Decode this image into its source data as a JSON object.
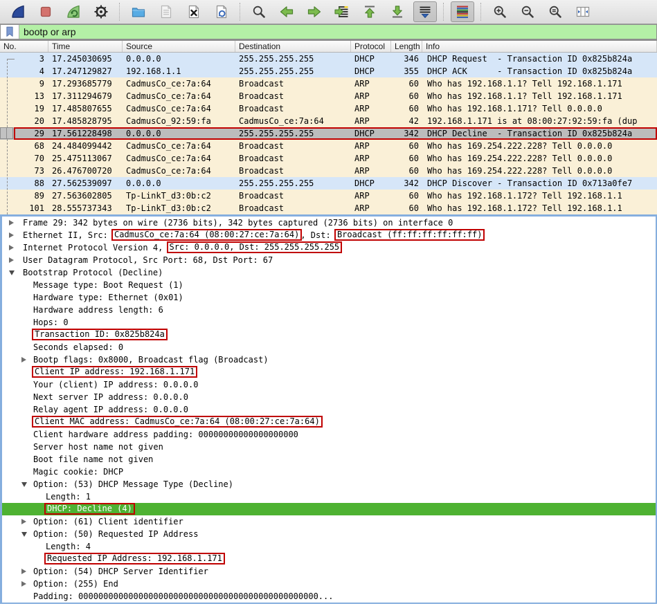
{
  "colors": {
    "dhcp_bg": "#d6e6f8",
    "arp_bg": "#faf0d7",
    "sel_bg": "#bcbcbc",
    "red": "#c00000",
    "green_sel": "#4eb232",
    "filter_green": "#b4f0a6",
    "focus": "#85aede"
  },
  "toolbar": {
    "buttons": [
      {
        "name": "start-capture",
        "icon": "wireshark-fin-icon",
        "group": 1
      },
      {
        "name": "stop-capture",
        "icon": "stop-icon",
        "group": 1
      },
      {
        "name": "restart-capture",
        "icon": "restart-fin-icon",
        "group": 1
      },
      {
        "name": "capture-options",
        "icon": "gear-icon",
        "group": 1
      },
      {
        "name": "open-file",
        "icon": "folder-icon",
        "group": 2
      },
      {
        "name": "save-file",
        "icon": "save-doc-icon",
        "group": 2,
        "disabled": true
      },
      {
        "name": "close-file",
        "icon": "close-doc-icon",
        "group": 2
      },
      {
        "name": "reload-file",
        "icon": "reload-doc-icon",
        "group": 2
      },
      {
        "name": "find-packet",
        "icon": "magnifier-icon",
        "group": 3
      },
      {
        "name": "go-previous-packet",
        "icon": "arrow-left-icon",
        "group": 3
      },
      {
        "name": "go-next-packet",
        "icon": "arrow-right-icon",
        "group": 3
      },
      {
        "name": "go-to-packet",
        "icon": "goto-packet-icon",
        "group": 3
      },
      {
        "name": "go-first-packet",
        "icon": "arrow-up-line-icon",
        "group": 3
      },
      {
        "name": "go-last-packet",
        "icon": "arrow-down-line-icon",
        "group": 3
      },
      {
        "name": "auto-scroll",
        "icon": "autoscroll-icon",
        "group": 3,
        "pressed": true
      },
      {
        "name": "colorize-packets",
        "icon": "colorize-icon",
        "group": 4,
        "pressed": true
      },
      {
        "name": "zoom-in",
        "icon": "zoom-in-icon",
        "group": 5
      },
      {
        "name": "zoom-out",
        "icon": "zoom-out-icon",
        "group": 5
      },
      {
        "name": "zoom-reset",
        "icon": "zoom-reset-icon",
        "group": 5
      },
      {
        "name": "resize-columns",
        "icon": "resize-columns-icon",
        "group": 5
      }
    ]
  },
  "filter": {
    "value": "bootp or arp",
    "bookmark_icon": "bookmark-icon"
  },
  "packet_list": {
    "columns": [
      "No.",
      "Time",
      "Source",
      "Destination",
      "Protocol",
      "Length",
      "Info"
    ],
    "rows": [
      {
        "no": "3",
        "time": "17.245030695",
        "source": "0.0.0.0",
        "destination": "255.255.255.255",
        "protocol": "DHCP",
        "length": "346",
        "info": "DHCP Request  - Transaction ID 0x825b824a",
        "kind": "dhcp"
      },
      {
        "no": "4",
        "time": "17.247129827",
        "source": "192.168.1.1",
        "destination": "255.255.255.255",
        "protocol": "DHCP",
        "length": "355",
        "info": "DHCP ACK      - Transaction ID 0x825b824a",
        "kind": "dhcp"
      },
      {
        "no": "9",
        "time": "17.293685779",
        "source": "CadmusCo_ce:7a:64",
        "destination": "Broadcast",
        "protocol": "ARP",
        "length": "60",
        "info": "Who has 192.168.1.1? Tell 192.168.1.171",
        "kind": "arp"
      },
      {
        "no": "13",
        "time": "17.311294679",
        "source": "CadmusCo_ce:7a:64",
        "destination": "Broadcast",
        "protocol": "ARP",
        "length": "60",
        "info": "Who has 192.168.1.1? Tell 192.168.1.171",
        "kind": "arp"
      },
      {
        "no": "19",
        "time": "17.485807655",
        "source": "CadmusCo_ce:7a:64",
        "destination": "Broadcast",
        "protocol": "ARP",
        "length": "60",
        "info": "Who has 192.168.1.171? Tell 0.0.0.0",
        "kind": "arp"
      },
      {
        "no": "20",
        "time": "17.485828795",
        "source": "CadmusCo_92:59:fa",
        "destination": "CadmusCo_ce:7a:64",
        "protocol": "ARP",
        "length": "42",
        "info": "192.168.1.171 is at 08:00:27:92:59:fa (dup",
        "kind": "arp"
      },
      {
        "no": "29",
        "time": "17.561228498",
        "source": "0.0.0.0",
        "destination": "255.255.255.255",
        "protocol": "DHCP",
        "length": "342",
        "info": "DHCP Decline  - Transaction ID 0x825b824a",
        "kind": "selected",
        "selected": true
      },
      {
        "no": "68",
        "time": "24.484099442",
        "source": "CadmusCo_ce:7a:64",
        "destination": "Broadcast",
        "protocol": "ARP",
        "length": "60",
        "info": "Who has 169.254.222.228? Tell 0.0.0.0",
        "kind": "arp"
      },
      {
        "no": "70",
        "time": "25.475113067",
        "source": "CadmusCo_ce:7a:64",
        "destination": "Broadcast",
        "protocol": "ARP",
        "length": "60",
        "info": "Who has 169.254.222.228? Tell 0.0.0.0",
        "kind": "arp"
      },
      {
        "no": "73",
        "time": "26.476700720",
        "source": "CadmusCo_ce:7a:64",
        "destination": "Broadcast",
        "protocol": "ARP",
        "length": "60",
        "info": "Who has 169.254.222.228? Tell 0.0.0.0",
        "kind": "arp"
      },
      {
        "no": "88",
        "time": "27.562539097",
        "source": "0.0.0.0",
        "destination": "255.255.255.255",
        "protocol": "DHCP",
        "length": "342",
        "info": "DHCP Discover - Transaction ID 0x713a0fe7",
        "kind": "dhcp"
      },
      {
        "no": "89",
        "time": "27.563602805",
        "source": "Tp-LinkT_d3:0b:c2",
        "destination": "Broadcast",
        "protocol": "ARP",
        "length": "60",
        "info": "Who has 192.168.1.172? Tell 192.168.1.1",
        "kind": "arp"
      },
      {
        "no": "101",
        "time": "28.555737343",
        "source": "Tp-LinkT_d3:0b:c2",
        "destination": "Broadcast",
        "protocol": "ARP",
        "length": "60",
        "info": "Who has 192.168.1.172? Tell 192.168.1.1",
        "kind": "arp"
      }
    ]
  },
  "packet_details": {
    "lines": [
      {
        "indent": 0,
        "expander": "collapsed",
        "parts": [
          {
            "text": "Frame 29: 342 bytes on wire (2736 bits), 342 bytes captured (2736 bits) on interface 0"
          }
        ]
      },
      {
        "indent": 0,
        "expander": "collapsed",
        "parts": [
          {
            "text": "Ethernet II, Src: "
          },
          {
            "text": "CadmusCo_ce:7a:64 (08:00:27:ce:7a:64)",
            "box": true
          },
          {
            "text": ", Dst: "
          },
          {
            "text": "Broadcast (ff:ff:ff:ff:ff:ff)",
            "box": true
          }
        ]
      },
      {
        "indent": 0,
        "expander": "collapsed",
        "parts": [
          {
            "text": "Internet Protocol Version 4, "
          },
          {
            "text": "Src: 0.0.0.0, Dst: 255.255.255.255",
            "box": true
          }
        ]
      },
      {
        "indent": 0,
        "expander": "collapsed",
        "parts": [
          {
            "text": "User Datagram Protocol, Src Port: 68, Dst Port: 67"
          }
        ]
      },
      {
        "indent": 0,
        "expander": "expanded",
        "parts": [
          {
            "text": "Bootstrap Protocol (Decline)"
          }
        ]
      },
      {
        "indent": 1,
        "expander": "",
        "parts": [
          {
            "text": "Message type: Boot Request (1)"
          }
        ]
      },
      {
        "indent": 1,
        "expander": "",
        "parts": [
          {
            "text": "Hardware type: Ethernet (0x01)"
          }
        ]
      },
      {
        "indent": 1,
        "expander": "",
        "parts": [
          {
            "text": "Hardware address length: 6"
          }
        ]
      },
      {
        "indent": 1,
        "expander": "",
        "parts": [
          {
            "text": "Hops: 0"
          }
        ]
      },
      {
        "indent": 1,
        "expander": "",
        "parts": [
          {
            "text": "Transaction ID: 0x825b824a",
            "box": true
          }
        ]
      },
      {
        "indent": 1,
        "expander": "",
        "parts": [
          {
            "text": "Seconds elapsed: 0"
          }
        ]
      },
      {
        "indent": 1,
        "expander": "collapsed",
        "parts": [
          {
            "text": "Bootp flags: 0x8000, Broadcast flag (Broadcast)"
          }
        ]
      },
      {
        "indent": 1,
        "expander": "",
        "parts": [
          {
            "text": "Client IP address: 192.168.1.171",
            "box": true
          }
        ]
      },
      {
        "indent": 1,
        "expander": "",
        "parts": [
          {
            "text": "Your (client) IP address: 0.0.0.0"
          }
        ]
      },
      {
        "indent": 1,
        "expander": "",
        "parts": [
          {
            "text": "Next server IP address: 0.0.0.0"
          }
        ]
      },
      {
        "indent": 1,
        "expander": "",
        "parts": [
          {
            "text": "Relay agent IP address: 0.0.0.0"
          }
        ]
      },
      {
        "indent": 1,
        "expander": "",
        "parts": [
          {
            "text": "Client MAC address: CadmusCo_ce:7a:64 (08:00:27:ce:7a:64)",
            "box": true
          }
        ]
      },
      {
        "indent": 1,
        "expander": "",
        "parts": [
          {
            "text": "Client hardware address padding: 00000000000000000000"
          }
        ]
      },
      {
        "indent": 1,
        "expander": "",
        "parts": [
          {
            "text": "Server host name not given"
          }
        ]
      },
      {
        "indent": 1,
        "expander": "",
        "parts": [
          {
            "text": "Boot file name not given"
          }
        ]
      },
      {
        "indent": 1,
        "expander": "",
        "parts": [
          {
            "text": "Magic cookie: DHCP"
          }
        ]
      },
      {
        "indent": 1,
        "expander": "expanded",
        "parts": [
          {
            "text": "Option: (53) DHCP Message Type (Decline)"
          }
        ]
      },
      {
        "indent": 2,
        "expander": "",
        "parts": [
          {
            "text": "Length: 1"
          }
        ]
      },
      {
        "indent": 2,
        "expander": "",
        "selected": true,
        "parts": [
          {
            "text": "DHCP: Decline (4)",
            "box": true
          }
        ]
      },
      {
        "indent": 1,
        "expander": "collapsed",
        "parts": [
          {
            "text": "Option: (61) Client identifier"
          }
        ]
      },
      {
        "indent": 1,
        "expander": "expanded",
        "parts": [
          {
            "text": "Option: (50) Requested IP Address"
          }
        ]
      },
      {
        "indent": 2,
        "expander": "",
        "parts": [
          {
            "text": "Length: 4"
          }
        ]
      },
      {
        "indent": 2,
        "expander": "",
        "parts": [
          {
            "text": "Requested IP Address: 192.168.1.171",
            "box": true
          }
        ]
      },
      {
        "indent": 1,
        "expander": "collapsed",
        "parts": [
          {
            "text": "Option: (54) DHCP Server Identifier"
          }
        ]
      },
      {
        "indent": 1,
        "expander": "collapsed",
        "parts": [
          {
            "text": "Option: (255) End"
          }
        ]
      },
      {
        "indent": 1,
        "expander": "",
        "parts": [
          {
            "text": "Padding: 000000000000000000000000000000000000000000000000..."
          }
        ]
      }
    ]
  }
}
